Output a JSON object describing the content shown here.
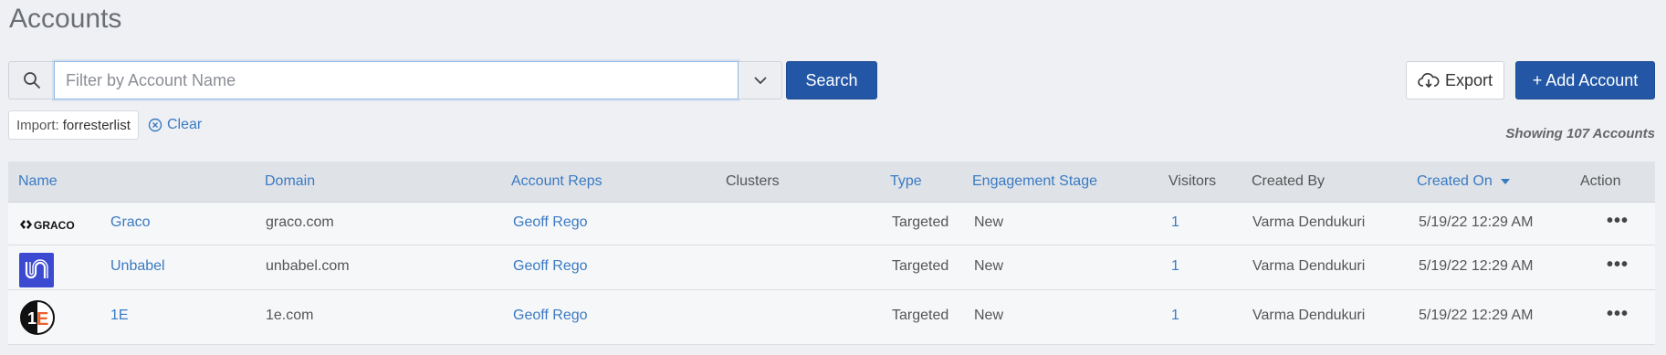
{
  "page": {
    "title": "Accounts"
  },
  "search": {
    "placeholder": "Filter by Account Name",
    "value": "",
    "button_label": "Search"
  },
  "actions": {
    "export_label": "Export",
    "add_label": "+ Add Account"
  },
  "filter": {
    "chip_prefix": "Import:",
    "chip_value": "forresterlist",
    "clear_label": "Clear"
  },
  "summary": {
    "showing": "Showing 107 Accounts"
  },
  "table": {
    "columns": {
      "name": "Name",
      "domain": "Domain",
      "account_reps": "Account Reps",
      "clusters": "Clusters",
      "type": "Type",
      "engagement_stage": "Engagement Stage",
      "visitors": "Visitors",
      "created_by": "Created By",
      "created_on": "Created On",
      "action": "Action"
    },
    "sort": {
      "column": "created_on",
      "direction": "desc"
    },
    "rows": [
      {
        "logo": "GRACO",
        "name": "Graco",
        "domain": "graco.com",
        "rep": "Geoff Rego",
        "clusters": "",
        "type": "Targeted",
        "stage": "New",
        "visitors": "1",
        "created_by": "Varma Dendukuri",
        "created_on": "5/19/22 12:29 AM",
        "action": "•••"
      },
      {
        "logo": "unbabel-logo",
        "name": "Unbabel",
        "domain": "unbabel.com",
        "rep": "Geoff Rego",
        "clusters": "",
        "type": "Targeted",
        "stage": "New",
        "visitors": "1",
        "created_by": "Varma Dendukuri",
        "created_on": "5/19/22 12:29 AM",
        "action": "•••"
      },
      {
        "logo": "1e-logo",
        "name": "1E",
        "domain": "1e.com",
        "rep": "Geoff Rego",
        "clusters": "",
        "type": "Targeted",
        "stage": "New",
        "visitors": "1",
        "created_by": "Varma Dendukuri",
        "created_on": "5/19/22 12:29 AM",
        "action": "•••"
      }
    ]
  },
  "colors": {
    "primary": "#2357a6",
    "link": "#3a7ac2",
    "background": "#eef0f4",
    "header_bg": "#dfe3e8",
    "unbabel_brand": "#3b4ad0",
    "oneE_orange": "#e8612c"
  }
}
